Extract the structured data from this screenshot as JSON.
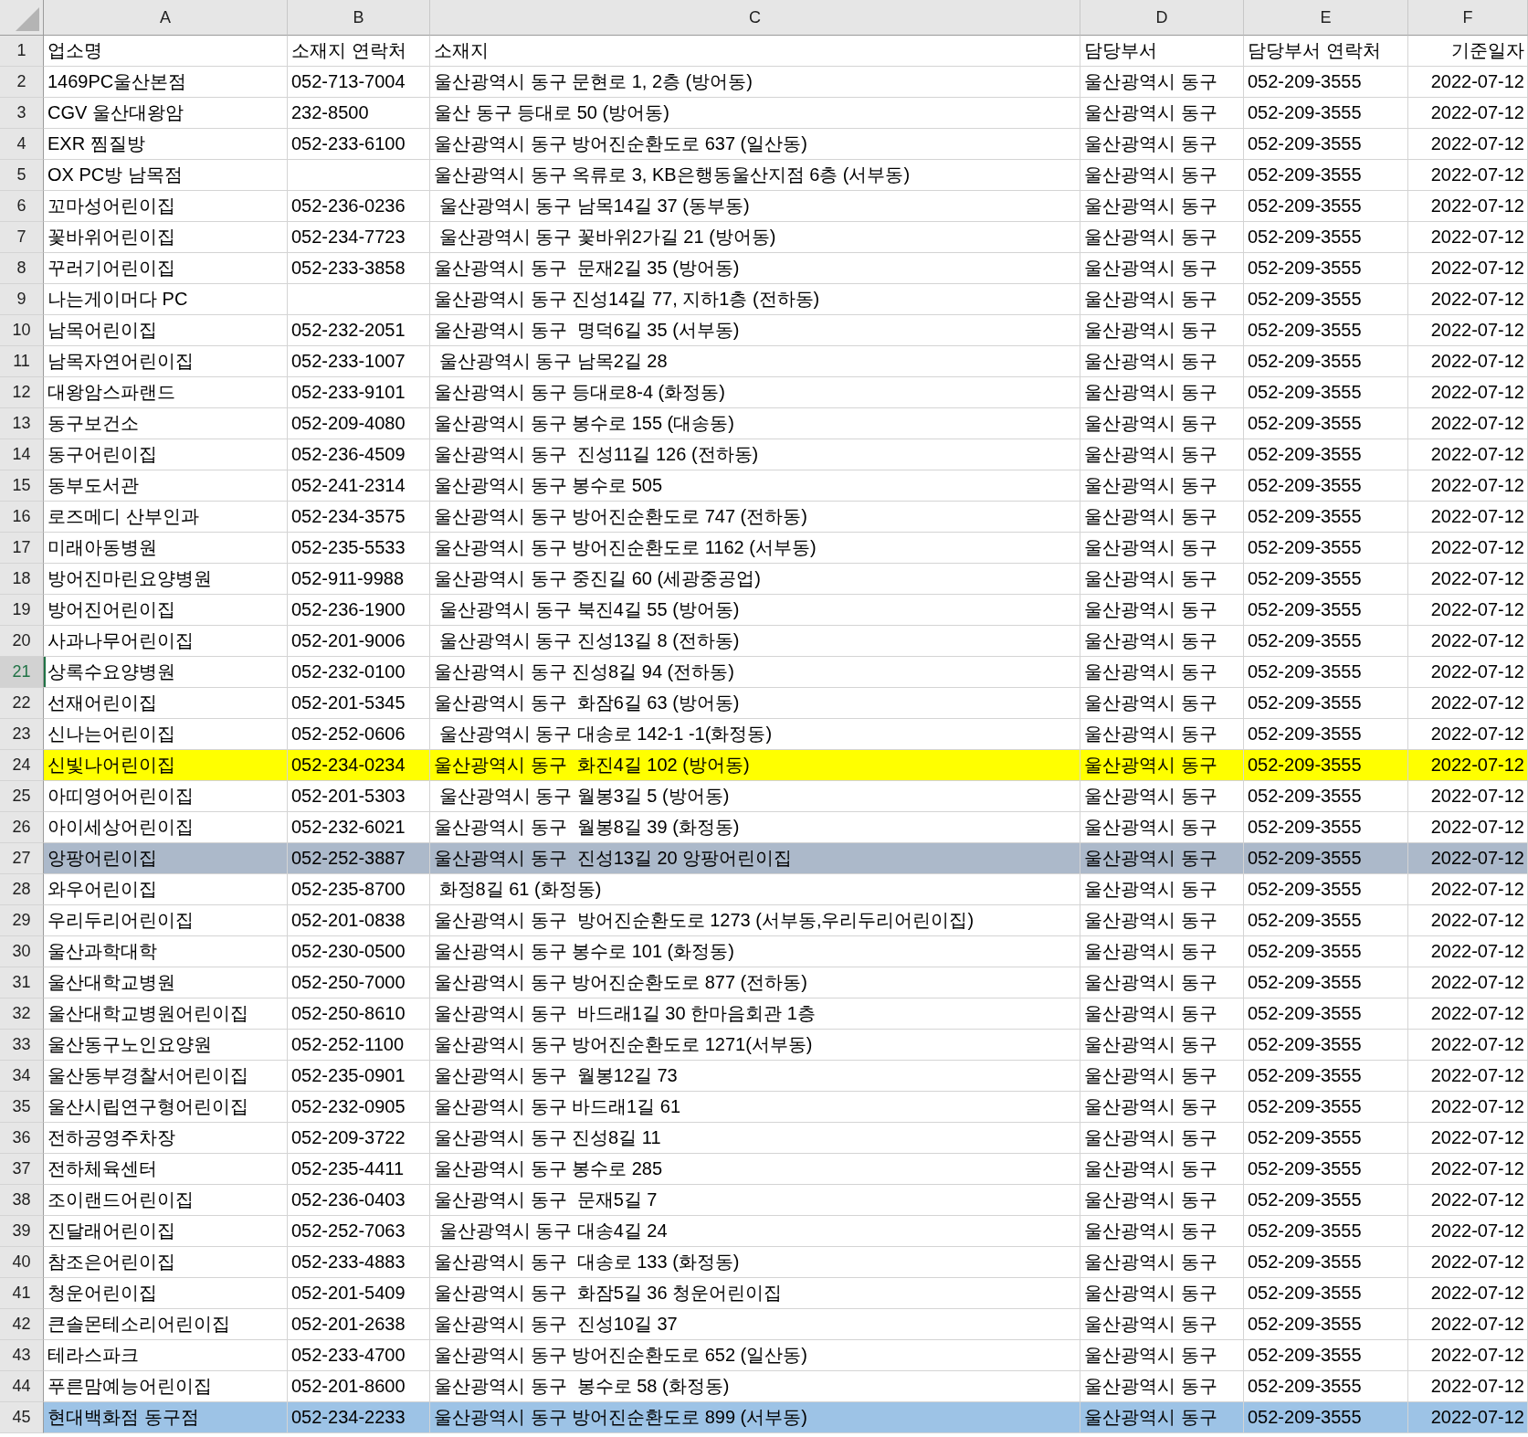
{
  "columns": [
    "A",
    "B",
    "C",
    "D",
    "E",
    "F"
  ],
  "rows": [
    {
      "number": "1",
      "selected": false,
      "cells": [
        "업소명",
        "소재지 연락처",
        "소재지",
        "담당부서",
        "담당부서 연락처",
        "기준일자"
      ]
    },
    {
      "number": "2",
      "selected": false,
      "cells": [
        "1469PC울산본점",
        "052-713-7004",
        "울산광역시 동구 문현로 1, 2층 (방어동)",
        "울산광역시 동구",
        "052-209-3555",
        "2022-07-12"
      ]
    },
    {
      "number": "3",
      "selected": false,
      "cells": [
        "CGV 울산대왕암",
        "232-8500",
        "울산 동구 등대로 50 (방어동)",
        "울산광역시 동구",
        "052-209-3555",
        "2022-07-12"
      ]
    },
    {
      "number": "4",
      "selected": false,
      "cells": [
        "EXR 찜질방",
        "052-233-6100",
        "울산광역시 동구 방어진순환도로 637 (일산동)",
        "울산광역시 동구",
        "052-209-3555",
        "2022-07-12"
      ]
    },
    {
      "number": "5",
      "selected": false,
      "cells": [
        "OX PC방 남목점",
        "",
        "울산광역시 동구 옥류로 3, KB은행동울산지점 6층 (서부동)",
        "울산광역시 동구",
        "052-209-3555",
        "2022-07-12"
      ]
    },
    {
      "number": "6",
      "selected": false,
      "cells": [
        "꼬마성어린이집",
        "052-236-0236",
        " 울산광역시 동구 남목14길 37 (동부동)",
        "울산광역시 동구",
        "052-209-3555",
        "2022-07-12"
      ]
    },
    {
      "number": "7",
      "selected": false,
      "cells": [
        "꽃바위어린이집",
        "052-234-7723",
        " 울산광역시 동구 꽃바위2가길 21 (방어동)",
        "울산광역시 동구",
        "052-209-3555",
        "2022-07-12"
      ]
    },
    {
      "number": "8",
      "selected": false,
      "cells": [
        "꾸러기어린이집",
        "052-233-3858",
        "울산광역시 동구  문재2길 35 (방어동)",
        "울산광역시 동구",
        "052-209-3555",
        "2022-07-12"
      ]
    },
    {
      "number": "9",
      "selected": false,
      "cells": [
        "나는게이머다 PC",
        "",
        "울산광역시 동구 진성14길 77, 지하1층 (전하동)",
        "울산광역시 동구",
        "052-209-3555",
        "2022-07-12"
      ]
    },
    {
      "number": "10",
      "selected": false,
      "cells": [
        "남목어린이집",
        "052-232-2051",
        "울산광역시 동구  명덕6길 35 (서부동)",
        "울산광역시 동구",
        "052-209-3555",
        "2022-07-12"
      ]
    },
    {
      "number": "11",
      "selected": false,
      "cells": [
        "남목자연어린이집",
        "052-233-1007",
        " 울산광역시 동구 남목2길 28",
        "울산광역시 동구",
        "052-209-3555",
        "2022-07-12"
      ]
    },
    {
      "number": "12",
      "selected": false,
      "cells": [
        "대왕암스파랜드",
        "052-233-9101",
        "울산광역시 동구 등대로8-4 (화정동)",
        "울산광역시 동구",
        "052-209-3555",
        "2022-07-12"
      ]
    },
    {
      "number": "13",
      "selected": false,
      "cells": [
        "동구보건소",
        "052-209-4080",
        "울산광역시 동구 봉수로 155 (대송동)",
        "울산광역시 동구",
        "052-209-3555",
        "2022-07-12"
      ]
    },
    {
      "number": "14",
      "selected": false,
      "cells": [
        "동구어린이집",
        "052-236-4509",
        "울산광역시 동구  진성11길 126 (전하동)",
        "울산광역시 동구",
        "052-209-3555",
        "2022-07-12"
      ]
    },
    {
      "number": "15",
      "selected": false,
      "cells": [
        "동부도서관",
        "052-241-2314",
        "울산광역시 동구 봉수로 505",
        "울산광역시 동구",
        "052-209-3555",
        "2022-07-12"
      ]
    },
    {
      "number": "16",
      "selected": false,
      "cells": [
        "로즈메디 산부인과",
        "052-234-3575",
        "울산광역시 동구 방어진순환도로 747 (전하동)",
        "울산광역시 동구",
        "052-209-3555",
        "2022-07-12"
      ]
    },
    {
      "number": "17",
      "selected": false,
      "cells": [
        "미래아동병원",
        "052-235-5533",
        "울산광역시 동구 방어진순환도로 1162 (서부동)",
        "울산광역시 동구",
        "052-209-3555",
        "2022-07-12"
      ]
    },
    {
      "number": "18",
      "selected": false,
      "cells": [
        "방어진마린요양병원",
        "052-911-9988",
        "울산광역시 동구 중진길 60 (세광중공업)",
        "울산광역시 동구",
        "052-209-3555",
        "2022-07-12"
      ]
    },
    {
      "number": "19",
      "selected": false,
      "cells": [
        "방어진어린이집",
        "052-236-1900",
        " 울산광역시 동구 북진4길 55 (방어동)",
        "울산광역시 동구",
        "052-209-3555",
        "2022-07-12"
      ]
    },
    {
      "number": "20",
      "selected": false,
      "cells": [
        "사과나무어린이집",
        "052-201-9006",
        " 울산광역시 동구 진성13길 8 (전하동)",
        "울산광역시 동구",
        "052-209-3555",
        "2022-07-12"
      ]
    },
    {
      "number": "21",
      "selected": true,
      "cells": [
        "상록수요양병원",
        "052-232-0100",
        "울산광역시 동구 진성8길 94 (전하동)",
        "울산광역시 동구",
        "052-209-3555",
        "2022-07-12"
      ]
    },
    {
      "number": "22",
      "selected": false,
      "cells": [
        "선재어린이집",
        "052-201-5345",
        "울산광역시 동구  화잠6길 63 (방어동)",
        "울산광역시 동구",
        "052-209-3555",
        "2022-07-12"
      ]
    },
    {
      "number": "23",
      "selected": false,
      "cells": [
        "신나는어린이집",
        "052-252-0606",
        " 울산광역시 동구 대송로 142-1 -1(화정동)",
        "울산광역시 동구",
        "052-209-3555",
        "2022-07-12"
      ]
    },
    {
      "number": "24",
      "selected": false,
      "color": "#ffff00",
      "cells": [
        "신빛나어린이집",
        "052-234-0234",
        "울산광역시 동구  화진4길 102 (방어동)",
        "울산광역시 동구",
        "052-209-3555",
        "2022-07-12"
      ]
    },
    {
      "number": "25",
      "selected": false,
      "cells": [
        "아띠영어어린이집",
        "052-201-5303",
        " 울산광역시 동구 월봉3길 5 (방어동)",
        "울산광역시 동구",
        "052-209-3555",
        "2022-07-12"
      ]
    },
    {
      "number": "26",
      "selected": false,
      "cells": [
        "아이세상어린이집",
        "052-232-6021",
        "울산광역시 동구  월봉8길 39 (화정동)",
        "울산광역시 동구",
        "052-209-3555",
        "2022-07-12"
      ]
    },
    {
      "number": "27",
      "selected": false,
      "color": "#acb9ca",
      "cells": [
        "앙팡어린이집",
        "052-252-3887",
        "울산광역시 동구  진성13길 20 앙팡어린이집",
        "울산광역시 동구",
        "052-209-3555",
        "2022-07-12"
      ]
    },
    {
      "number": "28",
      "selected": false,
      "cells": [
        "와우어린이집",
        "052-235-8700",
        " 화정8길 61 (화정동)",
        "울산광역시 동구",
        "052-209-3555",
        "2022-07-12"
      ]
    },
    {
      "number": "29",
      "selected": false,
      "cells": [
        "우리두리어린이집",
        "052-201-0838",
        "울산광역시 동구  방어진순환도로 1273 (서부동,우리두리어린이집)",
        "울산광역시 동구",
        "052-209-3555",
        "2022-07-12"
      ]
    },
    {
      "number": "30",
      "selected": false,
      "cells": [
        "울산과학대학",
        "052-230-0500",
        "울산광역시 동구 봉수로 101 (화정동)",
        "울산광역시 동구",
        "052-209-3555",
        "2022-07-12"
      ]
    },
    {
      "number": "31",
      "selected": false,
      "cells": [
        "울산대학교병원",
        "052-250-7000",
        "울산광역시 동구 방어진순환도로 877 (전하동)",
        "울산광역시 동구",
        "052-209-3555",
        "2022-07-12"
      ]
    },
    {
      "number": "32",
      "selected": false,
      "cells": [
        "울산대학교병원어린이집",
        "052-250-8610",
        "울산광역시 동구  바드래1길 30 한마음회관 1층",
        "울산광역시 동구",
        "052-209-3555",
        "2022-07-12"
      ]
    },
    {
      "number": "33",
      "selected": false,
      "cells": [
        "울산동구노인요양원",
        "052-252-1100",
        "울산광역시 동구 방어진순환도로 1271(서부동)",
        "울산광역시 동구",
        "052-209-3555",
        "2022-07-12"
      ]
    },
    {
      "number": "34",
      "selected": false,
      "cells": [
        "울산동부경찰서어린이집",
        "052-235-0901",
        "울산광역시 동구  월봉12길 73",
        "울산광역시 동구",
        "052-209-3555",
        "2022-07-12"
      ]
    },
    {
      "number": "35",
      "selected": false,
      "cells": [
        "울산시립연구형어린이집",
        "052-232-0905",
        "울산광역시 동구 바드래1길 61",
        "울산광역시 동구",
        "052-209-3555",
        "2022-07-12"
      ]
    },
    {
      "number": "36",
      "selected": false,
      "cells": [
        "전하공영주차장",
        "052-209-3722",
        "울산광역시 동구 진성8길 11",
        "울산광역시 동구",
        "052-209-3555",
        "2022-07-12"
      ]
    },
    {
      "number": "37",
      "selected": false,
      "cells": [
        "전하체육센터",
        "052-235-4411",
        "울산광역시 동구 봉수로 285",
        "울산광역시 동구",
        "052-209-3555",
        "2022-07-12"
      ]
    },
    {
      "number": "38",
      "selected": false,
      "cells": [
        "조이랜드어린이집",
        "052-236-0403",
        "울산광역시 동구  문재5길 7",
        "울산광역시 동구",
        "052-209-3555",
        "2022-07-12"
      ]
    },
    {
      "number": "39",
      "selected": false,
      "cells": [
        "진달래어린이집",
        "052-252-7063",
        " 울산광역시 동구 대송4길 24",
        "울산광역시 동구",
        "052-209-3555",
        "2022-07-12"
      ]
    },
    {
      "number": "40",
      "selected": false,
      "cells": [
        "참조은어린이집",
        "052-233-4883",
        "울산광역시 동구  대송로 133 (화정동)",
        "울산광역시 동구",
        "052-209-3555",
        "2022-07-12"
      ]
    },
    {
      "number": "41",
      "selected": false,
      "cells": [
        "청운어린이집",
        "052-201-5409",
        "울산광역시 동구  화잠5길 36 청운어린이집",
        "울산광역시 동구",
        "052-209-3555",
        "2022-07-12"
      ]
    },
    {
      "number": "42",
      "selected": false,
      "cells": [
        "큰솔몬테소리어린이집",
        "052-201-2638",
        "울산광역시 동구  진성10길 37",
        "울산광역시 동구",
        "052-209-3555",
        "2022-07-12"
      ]
    },
    {
      "number": "43",
      "selected": false,
      "cells": [
        "테라스파크",
        "052-233-4700",
        "울산광역시 동구 방어진순환도로 652 (일산동)",
        "울산광역시 동구",
        "052-209-3555",
        "2022-07-12"
      ]
    },
    {
      "number": "44",
      "selected": false,
      "cells": [
        "푸른맘예능어린이집",
        "052-201-8600",
        "울산광역시 동구  봉수로 58 (화정동)",
        "울산광역시 동구",
        "052-209-3555",
        "2022-07-12"
      ]
    },
    {
      "number": "45",
      "selected": false,
      "color": "#9dc3e6",
      "cells": [
        "현대백화점 동구점",
        "052-234-2233",
        "울산광역시 동구 방어진순환도로 899 (서부동)",
        "울산광역시 동구",
        "052-209-3555",
        "2022-07-12"
      ]
    }
  ]
}
